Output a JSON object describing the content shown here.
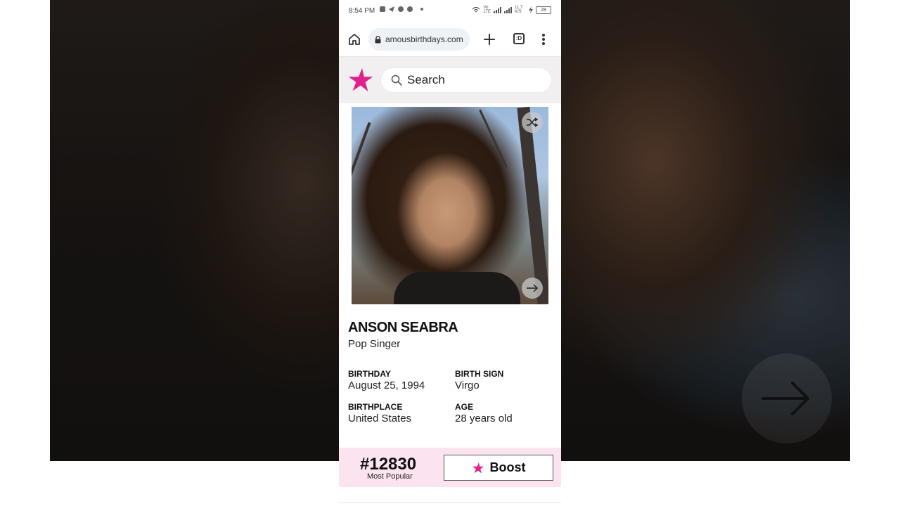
{
  "status_bar": {
    "time": "8:54 PM",
    "network_speed": "11.7 K/S",
    "battery": "28",
    "icons": [
      "notification-icon",
      "telegram-icon",
      "whatsapp-icon",
      "facebook-icon",
      "wifi-icon",
      "volte-icon",
      "signal-icon",
      "charging-icon",
      "battery-icon"
    ]
  },
  "browser": {
    "url": "amousbirthdays.com",
    "tabs_count": ":D"
  },
  "site": {
    "search_placeholder": "Search",
    "logo_color": "#e0218a"
  },
  "profile": {
    "name": "ANSON SEABRA",
    "profession": "Pop Singer",
    "facts": [
      {
        "label": "BIRTHDAY",
        "value": "August 25, 1994"
      },
      {
        "label": "BIRTH SIGN",
        "value": "Virgo"
      },
      {
        "label": "BIRTHPLACE",
        "value": "United States"
      },
      {
        "label": "AGE",
        "value": "28 years old"
      }
    ]
  },
  "popularity": {
    "rank": "#12830",
    "rank_label": "Most Popular",
    "boost_label": "Boost"
  },
  "colors": {
    "accent": "#e0218a",
    "rank_bar_bg": "#fbe4ef",
    "header_bg": "#f1efef"
  }
}
